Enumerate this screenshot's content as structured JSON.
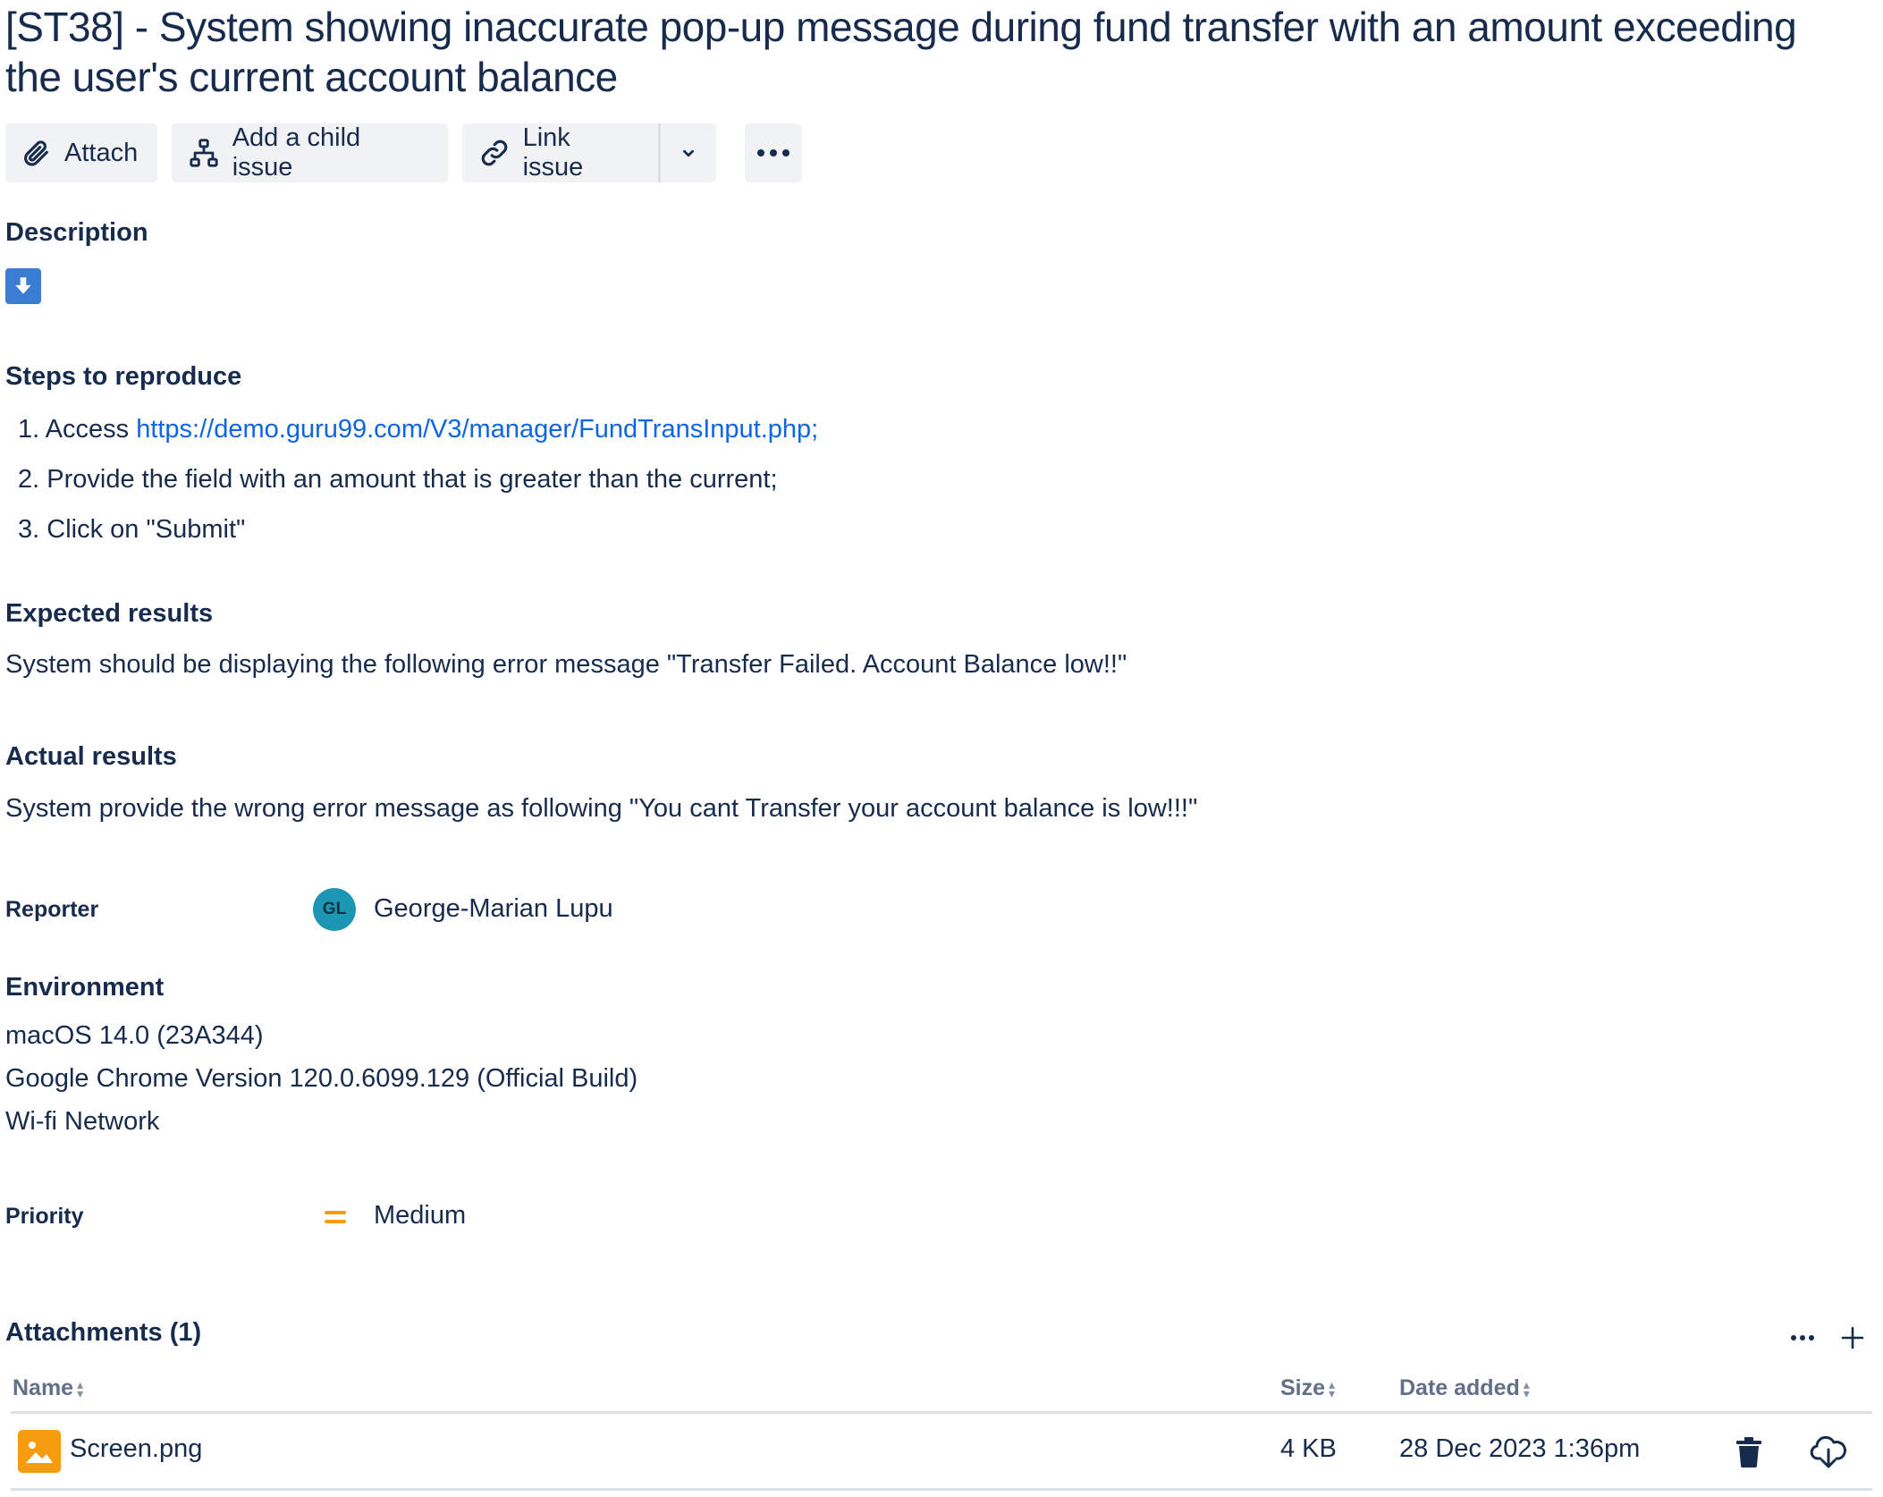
{
  "issue": {
    "title": "[ST38] - System showing inaccurate pop-up message during fund transfer with an amount exceeding the user's current account balance"
  },
  "toolbar": {
    "attach_label": "Attach",
    "child_label": "Add a child issue",
    "link_label": "Link issue"
  },
  "description": {
    "heading": "Description",
    "steps_heading": "Steps to reproduce",
    "steps": [
      {
        "num": "1.",
        "prefix": "Access ",
        "link": "https://demo.guru99.com/V3/manager/FundTransInput.php;"
      },
      {
        "num": "2.",
        "text": "Provide the field with an amount that is greater than the current;"
      },
      {
        "num": "3.",
        "text": "Click on \"Submit\""
      }
    ],
    "expected_heading": "Expected results",
    "expected_text": "System should be displaying the following error message \"Transfer Failed. Account Balance low!!\"",
    "actual_heading": "Actual results",
    "actual_text": "System provide the wrong error message as following \"You cant Transfer your account balance is low!!!\""
  },
  "reporter": {
    "label": "Reporter",
    "initials": "GL",
    "name": "George-Marian Lupu",
    "avatar_color": "#1d96b4"
  },
  "environment": {
    "heading": "Environment",
    "lines": [
      "macOS 14.0 (23A344)",
      "Google Chrome Version 120.0.6099.129 (Official Build)",
      "Wi-fi Network"
    ]
  },
  "priority": {
    "label": "Priority",
    "value": "Medium",
    "icon": "priority-medium-icon",
    "color": "#f79b0e"
  },
  "attachments": {
    "heading": "Attachments (1)",
    "columns": {
      "name": "Name",
      "size": "Size",
      "date": "Date added"
    },
    "files": [
      {
        "name": "Screen.png",
        "size": "4 KB",
        "date": "28 Dec 2023 1:36pm"
      }
    ]
  },
  "colors": {
    "text": "#172b4d",
    "link": "#0c66e4",
    "button_bg": "#f1f2f4",
    "download_badge": "#3a7dd2"
  }
}
